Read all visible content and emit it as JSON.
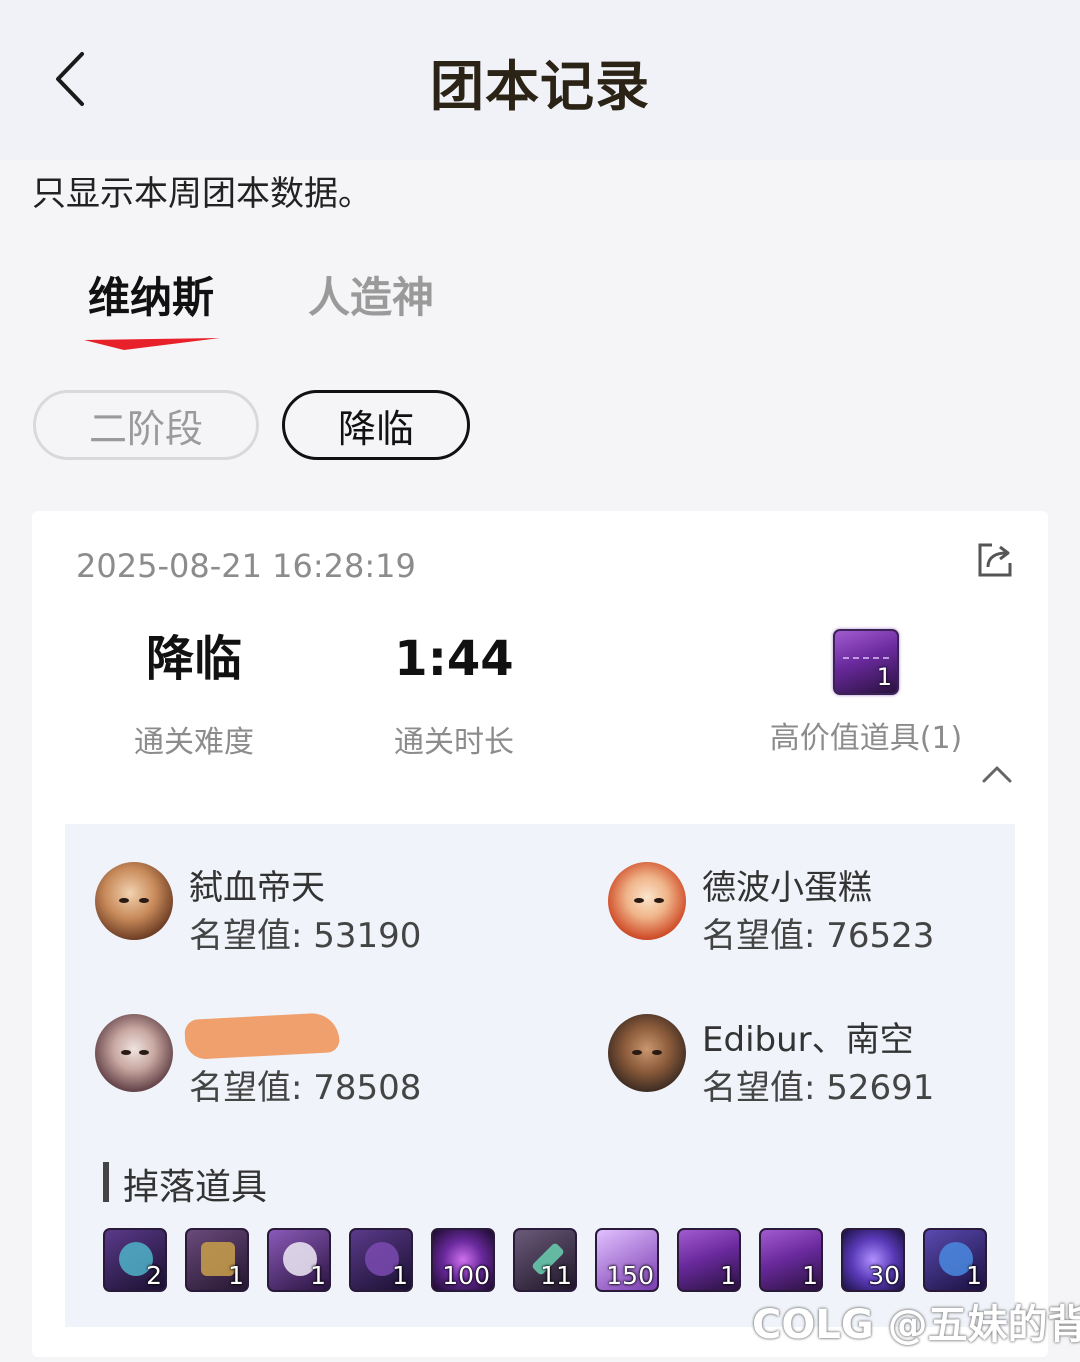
{
  "header": {
    "title": "团本记录"
  },
  "notice": "只显示本周团本数据。",
  "tabs": [
    {
      "label": "维纳斯",
      "active": true
    },
    {
      "label": "人造神",
      "active": false
    }
  ],
  "stages": [
    {
      "label": "二阶段",
      "selected": false
    },
    {
      "label": "降临",
      "selected": true
    }
  ],
  "record": {
    "datetime": "2025-08-21 16:28:19",
    "difficulty": {
      "value": "降临",
      "label": "通关难度"
    },
    "duration": {
      "value": "1:44",
      "label": "通关时长"
    },
    "high_value": {
      "count": "1",
      "label": "高价值道具(1)"
    },
    "players": [
      {
        "name": "弑血帝天",
        "reputation_label": "名望值:",
        "reputation": "53190"
      },
      {
        "name": "德波小蛋糕",
        "reputation_label": "名望值:",
        "reputation": "76523"
      },
      {
        "name": "",
        "reputation_label": "名望值:",
        "reputation": "78508"
      },
      {
        "name": "Edibur、南空",
        "reputation_label": "名望值:",
        "reputation": "52691"
      }
    ],
    "drops_title": "掉落道具",
    "drops": [
      {
        "count": "2"
      },
      {
        "count": "1"
      },
      {
        "count": "1"
      },
      {
        "count": "1"
      },
      {
        "count": "100"
      },
      {
        "count": "11"
      },
      {
        "count": "150"
      },
      {
        "count": "1"
      },
      {
        "count": "1"
      },
      {
        "count": "30"
      },
      {
        "count": "1"
      }
    ]
  },
  "colors": {
    "accent": "#e8202a",
    "title": "#2b2316",
    "muted": "#8c8c8c",
    "panel": "#f0f4fa",
    "epic": "#7a3cb0"
  },
  "watermark": "COLG @五妹的背"
}
